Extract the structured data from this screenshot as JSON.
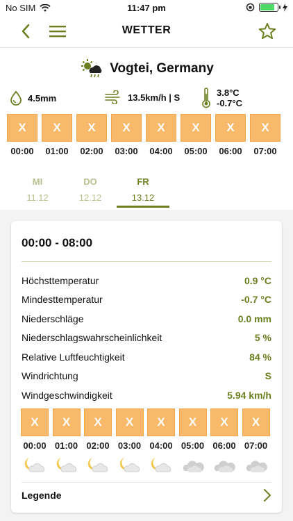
{
  "status": {
    "carrier": "No SIM",
    "time": "11:47 pm",
    "battery_level": 0.9
  },
  "nav": {
    "title": "WETTER"
  },
  "location": {
    "name": "Vogtei, Germany"
  },
  "metrics": {
    "precip": "4.5mm",
    "wind": "13.5km/h | S",
    "temp_max": "3.8°C",
    "temp_min": "-0.7°C"
  },
  "hours": {
    "boxes": [
      "X",
      "X",
      "X",
      "X",
      "X",
      "X",
      "X",
      "X"
    ],
    "labels": [
      "00:00",
      "01:00",
      "02:00",
      "03:00",
      "04:00",
      "05:00",
      "06:00",
      "07:00"
    ]
  },
  "days": [
    {
      "day": "MI",
      "date": "11.12"
    },
    {
      "day": "DO",
      "date": "12.12"
    },
    {
      "day": "FR",
      "date": "13.12"
    }
  ],
  "card": {
    "range": "00:00 - 08:00",
    "rows": [
      {
        "label": "Höchsttemperatur",
        "value": "0.9 °C"
      },
      {
        "label": "Mindesttemperatur",
        "value": "-0.7 °C"
      },
      {
        "label": "Niederschläge",
        "value": "0.0 mm"
      },
      {
        "label": "Niederschlagswahrscheinlichkeit",
        "value": "5 %"
      },
      {
        "label": "Relative Luftfeuchtigkeit",
        "value": "84 %"
      },
      {
        "label": "Windrichtung",
        "value": "S"
      },
      {
        "label": "Windgeschwindigkeit",
        "value": "5.94 km/h"
      }
    ],
    "hours": {
      "boxes": [
        "X",
        "X",
        "X",
        "X",
        "X",
        "X",
        "X",
        "X"
      ],
      "labels": [
        "00:00",
        "01:00",
        "02:00",
        "03:00",
        "04:00",
        "05:00",
        "06:00",
        "07:00"
      ],
      "icons": [
        "moon-cloud-icon",
        "moon-cloud-icon",
        "moon-cloud-icon",
        "moon-cloud-icon",
        "moon-cloud-icon",
        "cloud-icon",
        "cloud-icon",
        "cloud-icon"
      ]
    },
    "legend_label": "Legende"
  },
  "colors": {
    "accent": "#6b7f1f",
    "hour_box": "#f8b96a",
    "star": "#6b7f1f"
  }
}
